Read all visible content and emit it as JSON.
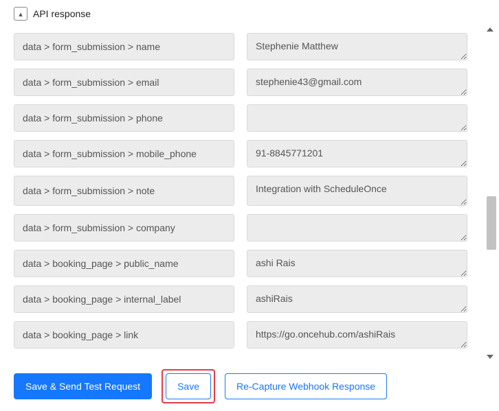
{
  "section": {
    "title": "API response"
  },
  "rows": [
    {
      "label": "data > form_submission > name",
      "value": "Stephenie Matthew"
    },
    {
      "label": "data > form_submission > email",
      "value": "stephenie43@gmail.com"
    },
    {
      "label": "data > form_submission > phone",
      "value": ""
    },
    {
      "label": "data > form_submission > mobile_phone",
      "value": "91-8845771201"
    },
    {
      "label": "data > form_submission > note",
      "value": "Integration with ScheduleOnce"
    },
    {
      "label": "data > form_submission > company",
      "value": ""
    },
    {
      "label": "data > booking_page > public_name",
      "value": "ashi Rais"
    },
    {
      "label": "data > booking_page > internal_label",
      "value": "ashiRais"
    },
    {
      "label": "data > booking_page > link",
      "value": "https://go.oncehub.com/ashiRais"
    }
  ],
  "footer": {
    "save_send_label": "Save & Send Test Request",
    "save_label": "Save",
    "recapture_label": "Re-Capture Webhook Response"
  }
}
